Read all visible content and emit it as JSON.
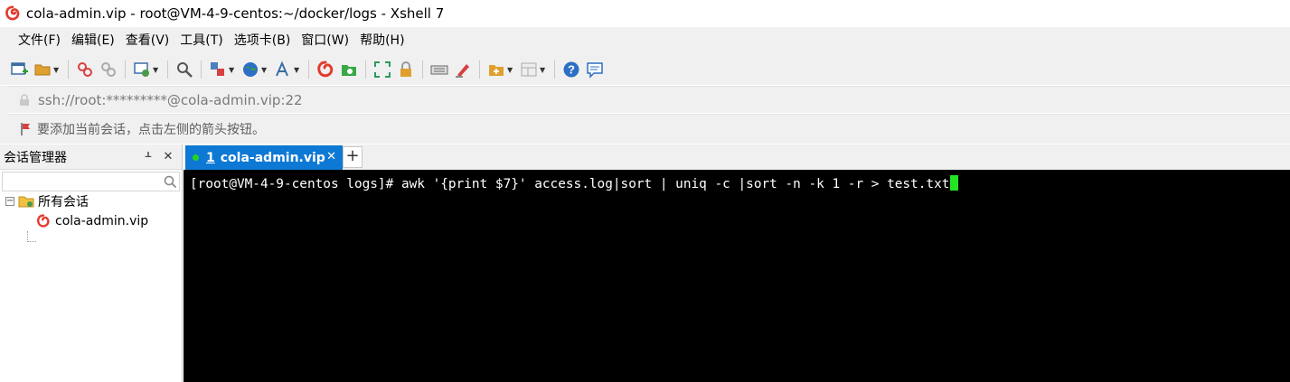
{
  "window": {
    "title": "cola-admin.vip - root@VM-4-9-centos:~/docker/logs - Xshell 7",
    "app_icon": "xshell-shell-icon"
  },
  "menu": {
    "items": [
      "文件(F)",
      "编辑(E)",
      "查看(V)",
      "工具(T)",
      "选项卡(B)",
      "窗口(W)",
      "帮助(H)"
    ]
  },
  "toolbar": {
    "buttons": [
      "new-session-icon",
      "open-folder-icon",
      "connect-icon",
      "disconnect-icon",
      "properties-icon",
      "find-icon",
      "transfer-icon",
      "globe-icon",
      "font-icon",
      "xshell-icon",
      "xftp-icon",
      "fullscreen-icon",
      "lock-icon",
      "keyboard-icon",
      "highlight-icon",
      "new-tab-group-icon",
      "layout-icon",
      "help-icon",
      "chat-icon"
    ]
  },
  "address": {
    "value": "ssh://root:*********@cola-admin.vip:22"
  },
  "hint": {
    "text": "要添加当前会话，点击左侧的箭头按钮。"
  },
  "session_manager": {
    "title": "会话管理器",
    "search_placeholder": "",
    "folder_label": "所有会话",
    "session_label": "cola-admin.vip"
  },
  "tabs": [
    {
      "number": "1",
      "label": "cola-admin.vip",
      "status_color": "#21d421"
    }
  ],
  "terminal": {
    "prompt": "[root@VM-4-9-centos logs]# ",
    "command": "awk '{print $7}' access.log|sort | uniq -c |sort -n -k 1 -r > test.txt",
    "background": "#000000",
    "cursor_color": "#23e323"
  },
  "colors": {
    "tab_active": "#0e79d4",
    "chrome": "#f0f0f0"
  }
}
